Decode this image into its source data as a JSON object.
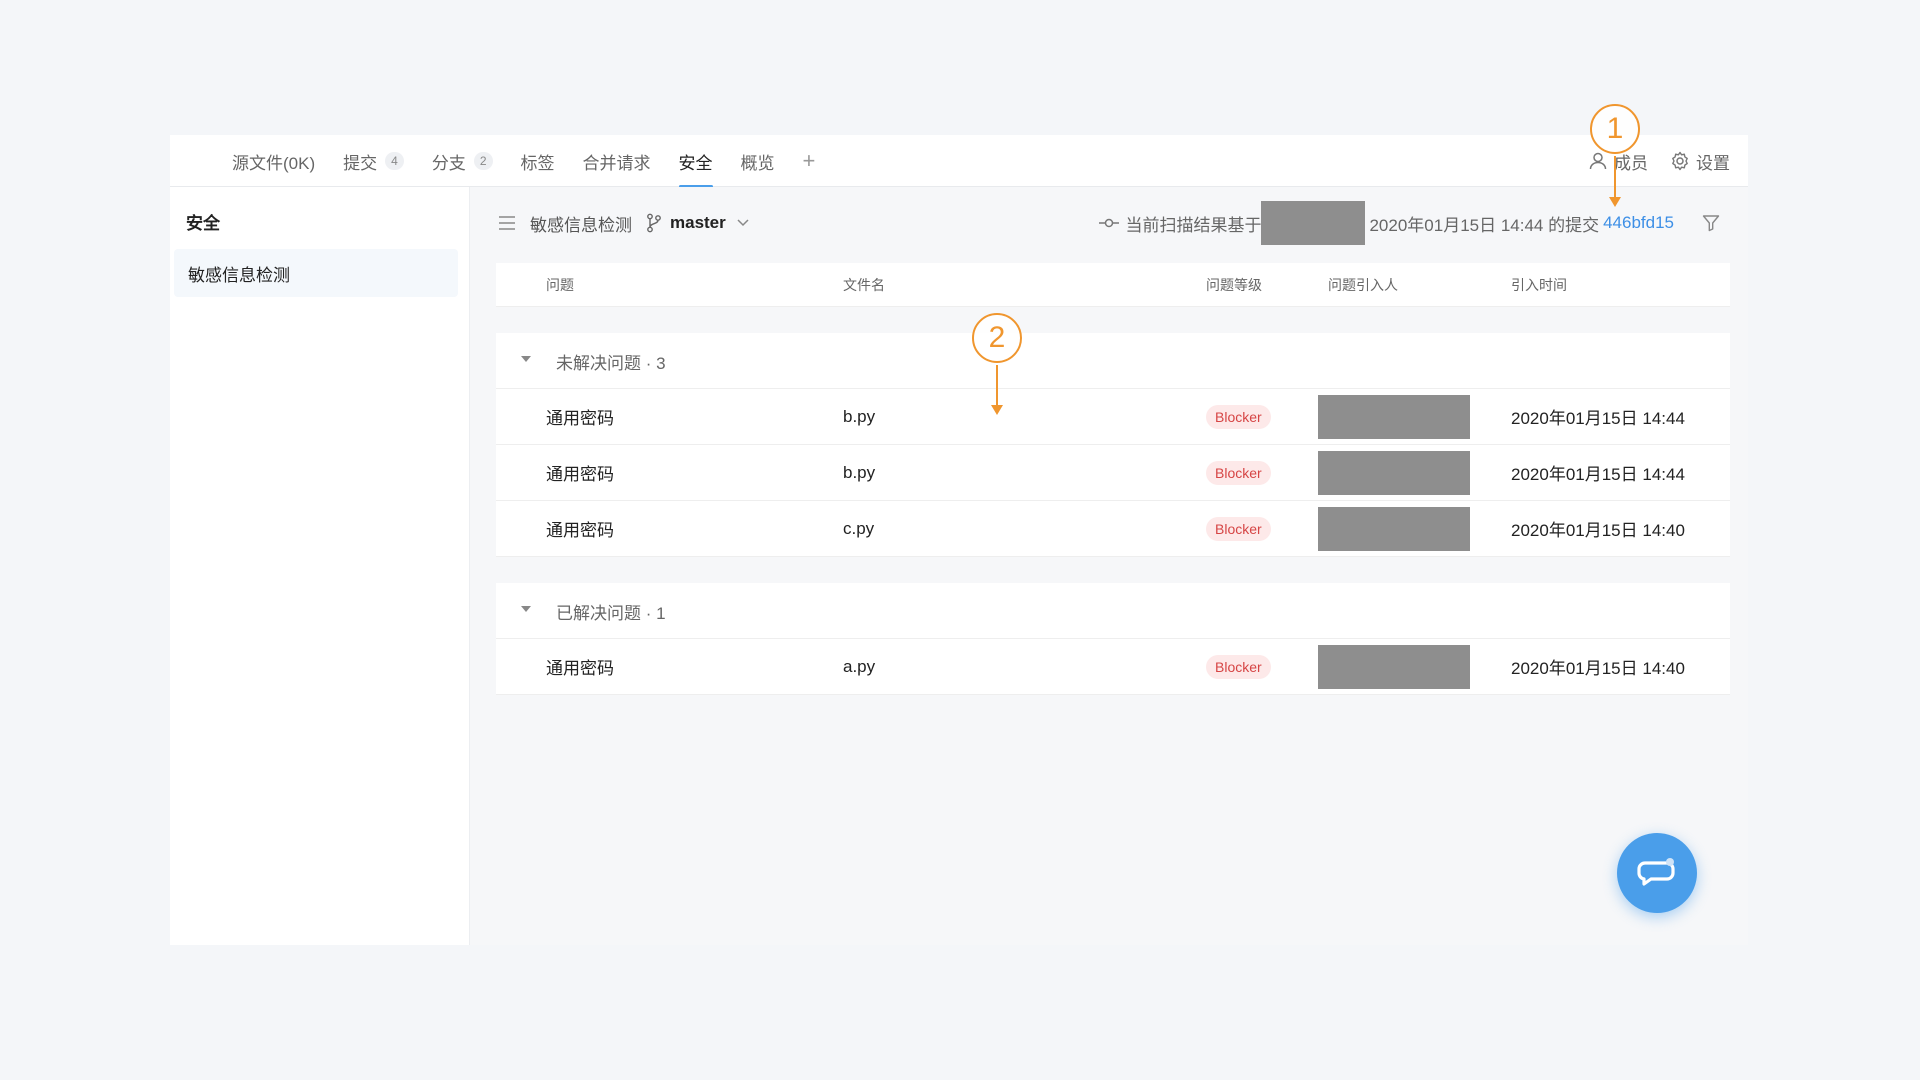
{
  "tabs": [
    {
      "label": "源文件(0K)",
      "count": ""
    },
    {
      "label": "提交",
      "count": "4"
    },
    {
      "label": "分支",
      "count": "2"
    },
    {
      "label": "标签",
      "count": ""
    },
    {
      "label": "合并请求",
      "count": ""
    },
    {
      "label": "安全",
      "count": "",
      "active": true
    },
    {
      "label": "概览",
      "count": ""
    }
  ],
  "tab_add": "+",
  "topright": {
    "members": "成员",
    "settings": "设置"
  },
  "sidebar": {
    "title": "安全",
    "item": "敏感信息检测"
  },
  "toolbar": {
    "title": "敏感信息检测",
    "branch": "master",
    "scan_prefix": "当前扫描结果基于",
    "scan_suffix": "2020年01月15日 14:44 的提交",
    "commit": "446bfd15"
  },
  "table": {
    "headers": [
      "问题",
      "文件名",
      "问题等级",
      "问题引入人",
      "引入时间"
    ],
    "groups": [
      {
        "title": "未解决问题 · 3",
        "rows": [
          {
            "issue": "通用密码",
            "file": "b.py",
            "level": "Blocker",
            "time": "2020年01月15日 14:44"
          },
          {
            "issue": "通用密码",
            "file": "b.py",
            "level": "Blocker",
            "time": "2020年01月15日 14:44"
          },
          {
            "issue": "通用密码",
            "file": "c.py",
            "level": "Blocker",
            "time": "2020年01月15日 14:40"
          }
        ]
      },
      {
        "title": "已解决问题 · 1",
        "rows": [
          {
            "issue": "通用密码",
            "file": "a.py",
            "level": "Blocker",
            "time": "2020年01月15日 14:40"
          }
        ]
      }
    ]
  },
  "annotations": [
    "1",
    "2"
  ],
  "colors": {
    "accent": "#4a9eea",
    "link": "#3d8fe6",
    "annotation": "#f0962e",
    "blocker": "#d64545",
    "redaction": "#8e8e8e"
  }
}
